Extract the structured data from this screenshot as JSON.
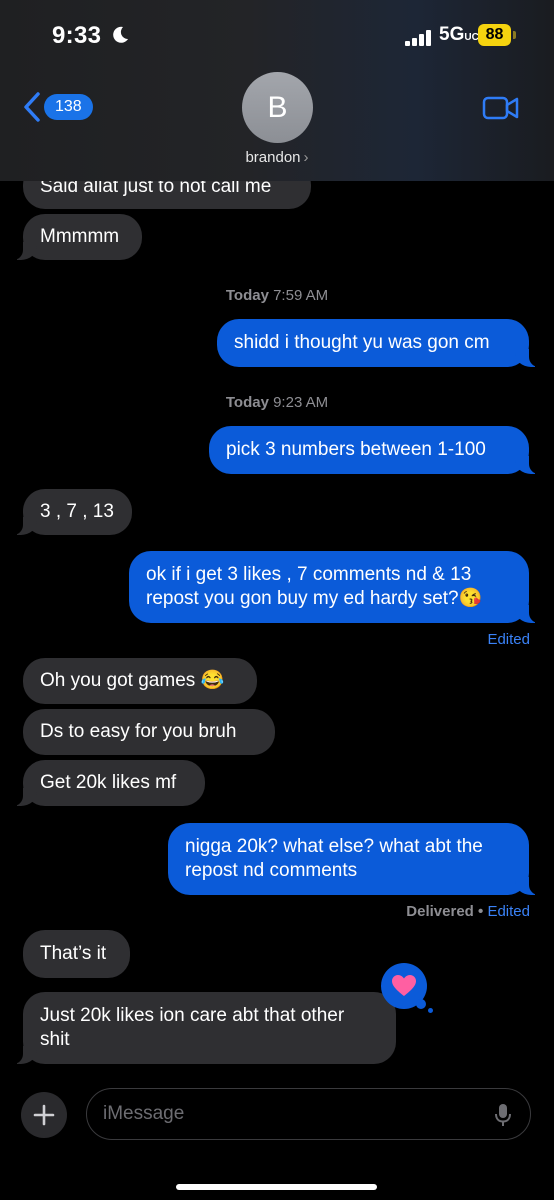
{
  "status_bar": {
    "time": "9:33",
    "network": "5G",
    "network_suffix": "UC",
    "battery": "88"
  },
  "header": {
    "back_count": "138",
    "avatar_initial": "B",
    "contact_name": "brandon"
  },
  "messages": [
    {
      "side": "in",
      "text": "Said allat just to not call me"
    },
    {
      "side": "in",
      "text": "Mmmmm"
    },
    {
      "type": "timestamp",
      "day": "Today",
      "time": "7:59 AM"
    },
    {
      "side": "out",
      "text": "shidd i thought yu was gon cm"
    },
    {
      "type": "timestamp",
      "day": "Today",
      "time": "9:23 AM"
    },
    {
      "side": "out",
      "text": "pick 3 numbers between 1-100"
    },
    {
      "side": "in",
      "text": "3 , 7 , 13"
    },
    {
      "side": "out",
      "lines": [
        "ok if i get 3 likes , 7 comments nd & 13",
        "repost you gon buy my ed hardy set?😘"
      ]
    },
    {
      "type": "meta",
      "edited": "Edited"
    },
    {
      "side": "in",
      "text": "Oh you got games 😂"
    },
    {
      "side": "in",
      "text": "Ds to easy for you bruh"
    },
    {
      "side": "in",
      "text": "Get 20k likes mf"
    },
    {
      "side": "out",
      "lines": [
        "nigga 20k? what else? what abt the",
        "repost nd comments"
      ]
    },
    {
      "type": "meta",
      "delivered": "Delivered",
      "separator": "•",
      "edited": "Edited"
    },
    {
      "side": "in",
      "text": "That’s it"
    },
    {
      "side": "in",
      "lines": [
        "Just 20k likes ion care abt that other",
        "shit"
      ],
      "tapback": "heart"
    }
  ],
  "composer": {
    "placeholder": "iMessage"
  },
  "colors": {
    "incoming": "#2f2f32",
    "outgoing": "#0b5bd9",
    "link": "#3a82f7",
    "battery": "#f5d30f",
    "tapback_heart": "#ff5fa2"
  }
}
